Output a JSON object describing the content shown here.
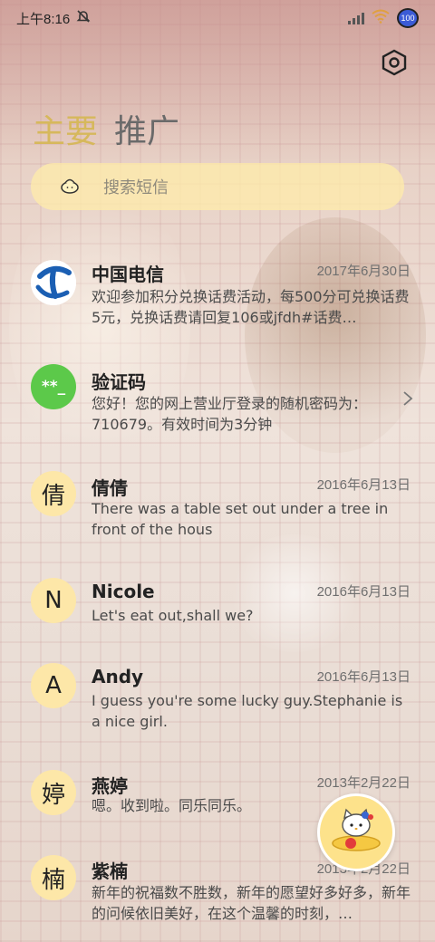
{
  "status_bar": {
    "time": "上午8:16",
    "battery": "100"
  },
  "tabs": {
    "main": "主要",
    "promo": "推广"
  },
  "search": {
    "placeholder": "搜索短信"
  },
  "messages": [
    {
      "name": "中国电信",
      "date": "2017年6月30日",
      "preview": "欢迎参加积分兑换话费活动，每500分可兑换话费5元，兑换话费请回复106或jfdh#话费…"
    },
    {
      "name": "验证码",
      "avatar_text": "**_",
      "date": "",
      "preview": "您好！您的网上营业厅登录的随机密码为：710679。有效时间为3分钟"
    },
    {
      "name": "倩倩",
      "avatar_text": "倩",
      "date": "2016年6月13日",
      "preview": "There was a table set out under a tree in front of the hous"
    },
    {
      "name": "Nicole",
      "avatar_text": "N",
      "date": "2016年6月13日",
      "preview": "Let's eat out,shall we?"
    },
    {
      "name": "Andy",
      "avatar_text": "A",
      "date": "2016年6月13日",
      "preview": "I guess you're some lucky guy.Stephanie is a nice girl."
    },
    {
      "name": "燕婷",
      "avatar_text": "婷",
      "date": "2013年2月22日",
      "preview": "嗯。收到啦。同乐同乐。"
    },
    {
      "name": "紫楠",
      "avatar_text": "楠",
      "date": "2013年2月22日",
      "preview": "新年的祝福数不胜数，新年的愿望好多好多，新年的问候依旧美好，在这个温馨的时刻，…"
    }
  ],
  "icons": {
    "settings": "settings-hex-icon",
    "search": "search-bun-icon",
    "chevron": "chevron-right-icon",
    "fab": "compose-kitty-icon"
  },
  "colors": {
    "tab_active": "#d6b85c",
    "tab_inactive": "#6a6a6a",
    "search_bg": "#ffecaa",
    "avatar_letter_bg": "#fde7a8",
    "verify_green": "#5cc94a",
    "telecom_blue": "#1b5fb3"
  }
}
